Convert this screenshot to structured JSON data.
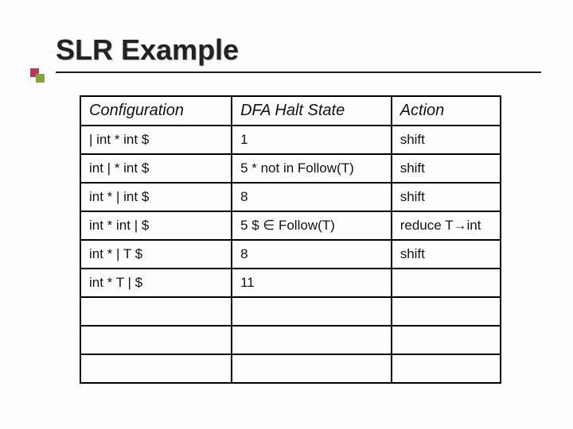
{
  "title": "SLR Example",
  "table": {
    "headers": [
      "Configuration",
      "DFA Halt State",
      "Action"
    ],
    "rows": [
      {
        "config": "| int * int $",
        "halt": "1",
        "action": "shift"
      },
      {
        "config": "int | * int $",
        "halt": "5   * not in Follow(T)",
        "action": "shift"
      },
      {
        "config": "int * | int $",
        "halt": "8",
        "action": "shift"
      },
      {
        "config": "int * int | $",
        "halt": "5   $ ∈ Follow(T)",
        "action": "reduce T→int"
      },
      {
        "config": "int * | T $",
        "halt": "8",
        "action": "shift"
      },
      {
        "config": "int * T | $",
        "halt": "11",
        "action": ""
      },
      {
        "config": "",
        "halt": "",
        "action": ""
      },
      {
        "config": "",
        "halt": "",
        "action": ""
      },
      {
        "config": "",
        "halt": "",
        "action": ""
      }
    ]
  }
}
